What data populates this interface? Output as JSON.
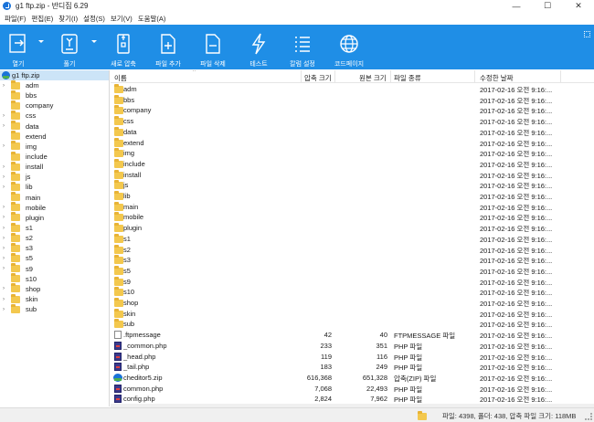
{
  "window": {
    "title": "g1 ftp.zip - 반디집 6.29",
    "min": "—",
    "max": "☐",
    "close": "✕"
  },
  "menu": [
    "파일(F)",
    "편집(E)",
    "찾기(I)",
    "설정(S)",
    "보기(V)",
    "도움말(A)"
  ],
  "toolbar": {
    "open": "열기",
    "extract": "풀기",
    "new_archive": "새로 압축",
    "add_file": "파일 추가",
    "delete_file": "파일 삭제",
    "test": "테스트",
    "column_settings": "칼럼 설정",
    "homepage": "코드페이지"
  },
  "tree": {
    "root": "g1 ftp.zip",
    "items": [
      {
        "label": "adm",
        "arrow": true
      },
      {
        "label": "bbs",
        "arrow": false
      },
      {
        "label": "company",
        "arrow": false
      },
      {
        "label": "css",
        "arrow": true
      },
      {
        "label": "data",
        "arrow": true
      },
      {
        "label": "extend",
        "arrow": false
      },
      {
        "label": "img",
        "arrow": true
      },
      {
        "label": "include",
        "arrow": false
      },
      {
        "label": "install",
        "arrow": true
      },
      {
        "label": "js",
        "arrow": true
      },
      {
        "label": "lib",
        "arrow": true
      },
      {
        "label": "main",
        "arrow": false
      },
      {
        "label": "mobile",
        "arrow": true
      },
      {
        "label": "plugin",
        "arrow": true
      },
      {
        "label": "s1",
        "arrow": true
      },
      {
        "label": "s2",
        "arrow": true
      },
      {
        "label": "s3",
        "arrow": true
      },
      {
        "label": "s5",
        "arrow": true
      },
      {
        "label": "s9",
        "arrow": true
      },
      {
        "label": "s10",
        "arrow": false
      },
      {
        "label": "shop",
        "arrow": true
      },
      {
        "label": "skin",
        "arrow": true
      },
      {
        "label": "sub",
        "arrow": true
      }
    ]
  },
  "columns": {
    "name": "이름",
    "compressed": "압축 크기",
    "original": "원본 크기",
    "type": "파일 종류",
    "modified": "수정한 날짜"
  },
  "sort_indicator": "^",
  "rows": [
    {
      "name": "adm",
      "kind": "folder",
      "compressed": "",
      "original": "",
      "type": "",
      "modified": "2017-02-16 오전 9:16:..."
    },
    {
      "name": "bbs",
      "kind": "folder",
      "compressed": "",
      "original": "",
      "type": "",
      "modified": "2017-02-16 오전 9:16:..."
    },
    {
      "name": "company",
      "kind": "folder",
      "compressed": "",
      "original": "",
      "type": "",
      "modified": "2017-02-16 오전 9:16:..."
    },
    {
      "name": "css",
      "kind": "folder",
      "compressed": "",
      "original": "",
      "type": "",
      "modified": "2017-02-16 오전 9:16:..."
    },
    {
      "name": "data",
      "kind": "folder",
      "compressed": "",
      "original": "",
      "type": "",
      "modified": "2017-02-16 오전 9:16:..."
    },
    {
      "name": "extend",
      "kind": "folder",
      "compressed": "",
      "original": "",
      "type": "",
      "modified": "2017-02-16 오전 9:16:..."
    },
    {
      "name": "img",
      "kind": "folder",
      "compressed": "",
      "original": "",
      "type": "",
      "modified": "2017-02-16 오전 9:16:..."
    },
    {
      "name": "include",
      "kind": "folder",
      "compressed": "",
      "original": "",
      "type": "",
      "modified": "2017-02-16 오전 9:16:..."
    },
    {
      "name": "install",
      "kind": "folder",
      "compressed": "",
      "original": "",
      "type": "",
      "modified": "2017-02-16 오전 9:16:..."
    },
    {
      "name": "js",
      "kind": "folder",
      "compressed": "",
      "original": "",
      "type": "",
      "modified": "2017-02-16 오전 9:16:..."
    },
    {
      "name": "lib",
      "kind": "folder",
      "compressed": "",
      "original": "",
      "type": "",
      "modified": "2017-02-16 오전 9:16:..."
    },
    {
      "name": "main",
      "kind": "folder",
      "compressed": "",
      "original": "",
      "type": "",
      "modified": "2017-02-16 오전 9:16:..."
    },
    {
      "name": "mobile",
      "kind": "folder",
      "compressed": "",
      "original": "",
      "type": "",
      "modified": "2017-02-16 오전 9:16:..."
    },
    {
      "name": "plugin",
      "kind": "folder",
      "compressed": "",
      "original": "",
      "type": "",
      "modified": "2017-02-16 오전 9:16:..."
    },
    {
      "name": "s1",
      "kind": "folder",
      "compressed": "",
      "original": "",
      "type": "",
      "modified": "2017-02-16 오전 9:16:..."
    },
    {
      "name": "s2",
      "kind": "folder",
      "compressed": "",
      "original": "",
      "type": "",
      "modified": "2017-02-16 오전 9:16:..."
    },
    {
      "name": "s3",
      "kind": "folder",
      "compressed": "",
      "original": "",
      "type": "",
      "modified": "2017-02-16 오전 9:16:..."
    },
    {
      "name": "s5",
      "kind": "folder",
      "compressed": "",
      "original": "",
      "type": "",
      "modified": "2017-02-16 오전 9:16:..."
    },
    {
      "name": "s9",
      "kind": "folder",
      "compressed": "",
      "original": "",
      "type": "",
      "modified": "2017-02-16 오전 9:16:..."
    },
    {
      "name": "s10",
      "kind": "folder",
      "compressed": "",
      "original": "",
      "type": "",
      "modified": "2017-02-16 오전 9:16:..."
    },
    {
      "name": "shop",
      "kind": "folder",
      "compressed": "",
      "original": "",
      "type": "",
      "modified": "2017-02-16 오전 9:16:..."
    },
    {
      "name": "skin",
      "kind": "folder",
      "compressed": "",
      "original": "",
      "type": "",
      "modified": "2017-02-16 오전 9:16:..."
    },
    {
      "name": "sub",
      "kind": "folder",
      "compressed": "",
      "original": "",
      "type": "",
      "modified": "2017-02-16 오전 9:16:..."
    },
    {
      "name": ".ftpmessage",
      "kind": "file",
      "compressed": "42",
      "original": "40",
      "type": "FTPMESSAGE 파일",
      "modified": "2017-02-16 오전 9:16:..."
    },
    {
      "name": "_common.php",
      "kind": "php",
      "compressed": "233",
      "original": "351",
      "type": "PHP 파일",
      "modified": "2017-02-16 오전 9:16:..."
    },
    {
      "name": "_head.php",
      "kind": "php",
      "compressed": "119",
      "original": "116",
      "type": "PHP 파일",
      "modified": "2017-02-16 오전 9:16:..."
    },
    {
      "name": "_tail.php",
      "kind": "php",
      "compressed": "183",
      "original": "249",
      "type": "PHP 파일",
      "modified": "2017-02-16 오전 9:16:..."
    },
    {
      "name": "cheditor5.zip",
      "kind": "zip",
      "compressed": "616,368",
      "original": "651,328",
      "type": "압축(ZIP) 파일",
      "modified": "2017-02-16 오전 9:16:..."
    },
    {
      "name": "common.php",
      "kind": "php",
      "compressed": "7,068",
      "original": "22,493",
      "type": "PHP 파일",
      "modified": "2017-02-16 오전 9:16:..."
    },
    {
      "name": "config.php",
      "kind": "php",
      "compressed": "2,824",
      "original": "7,962",
      "type": "PHP 파일",
      "modified": "2017-02-16 오전 9:16:..."
    }
  ],
  "status": {
    "text": "파일: 4398, 폴더: 438, 압축 파일 크기: 118MB"
  }
}
